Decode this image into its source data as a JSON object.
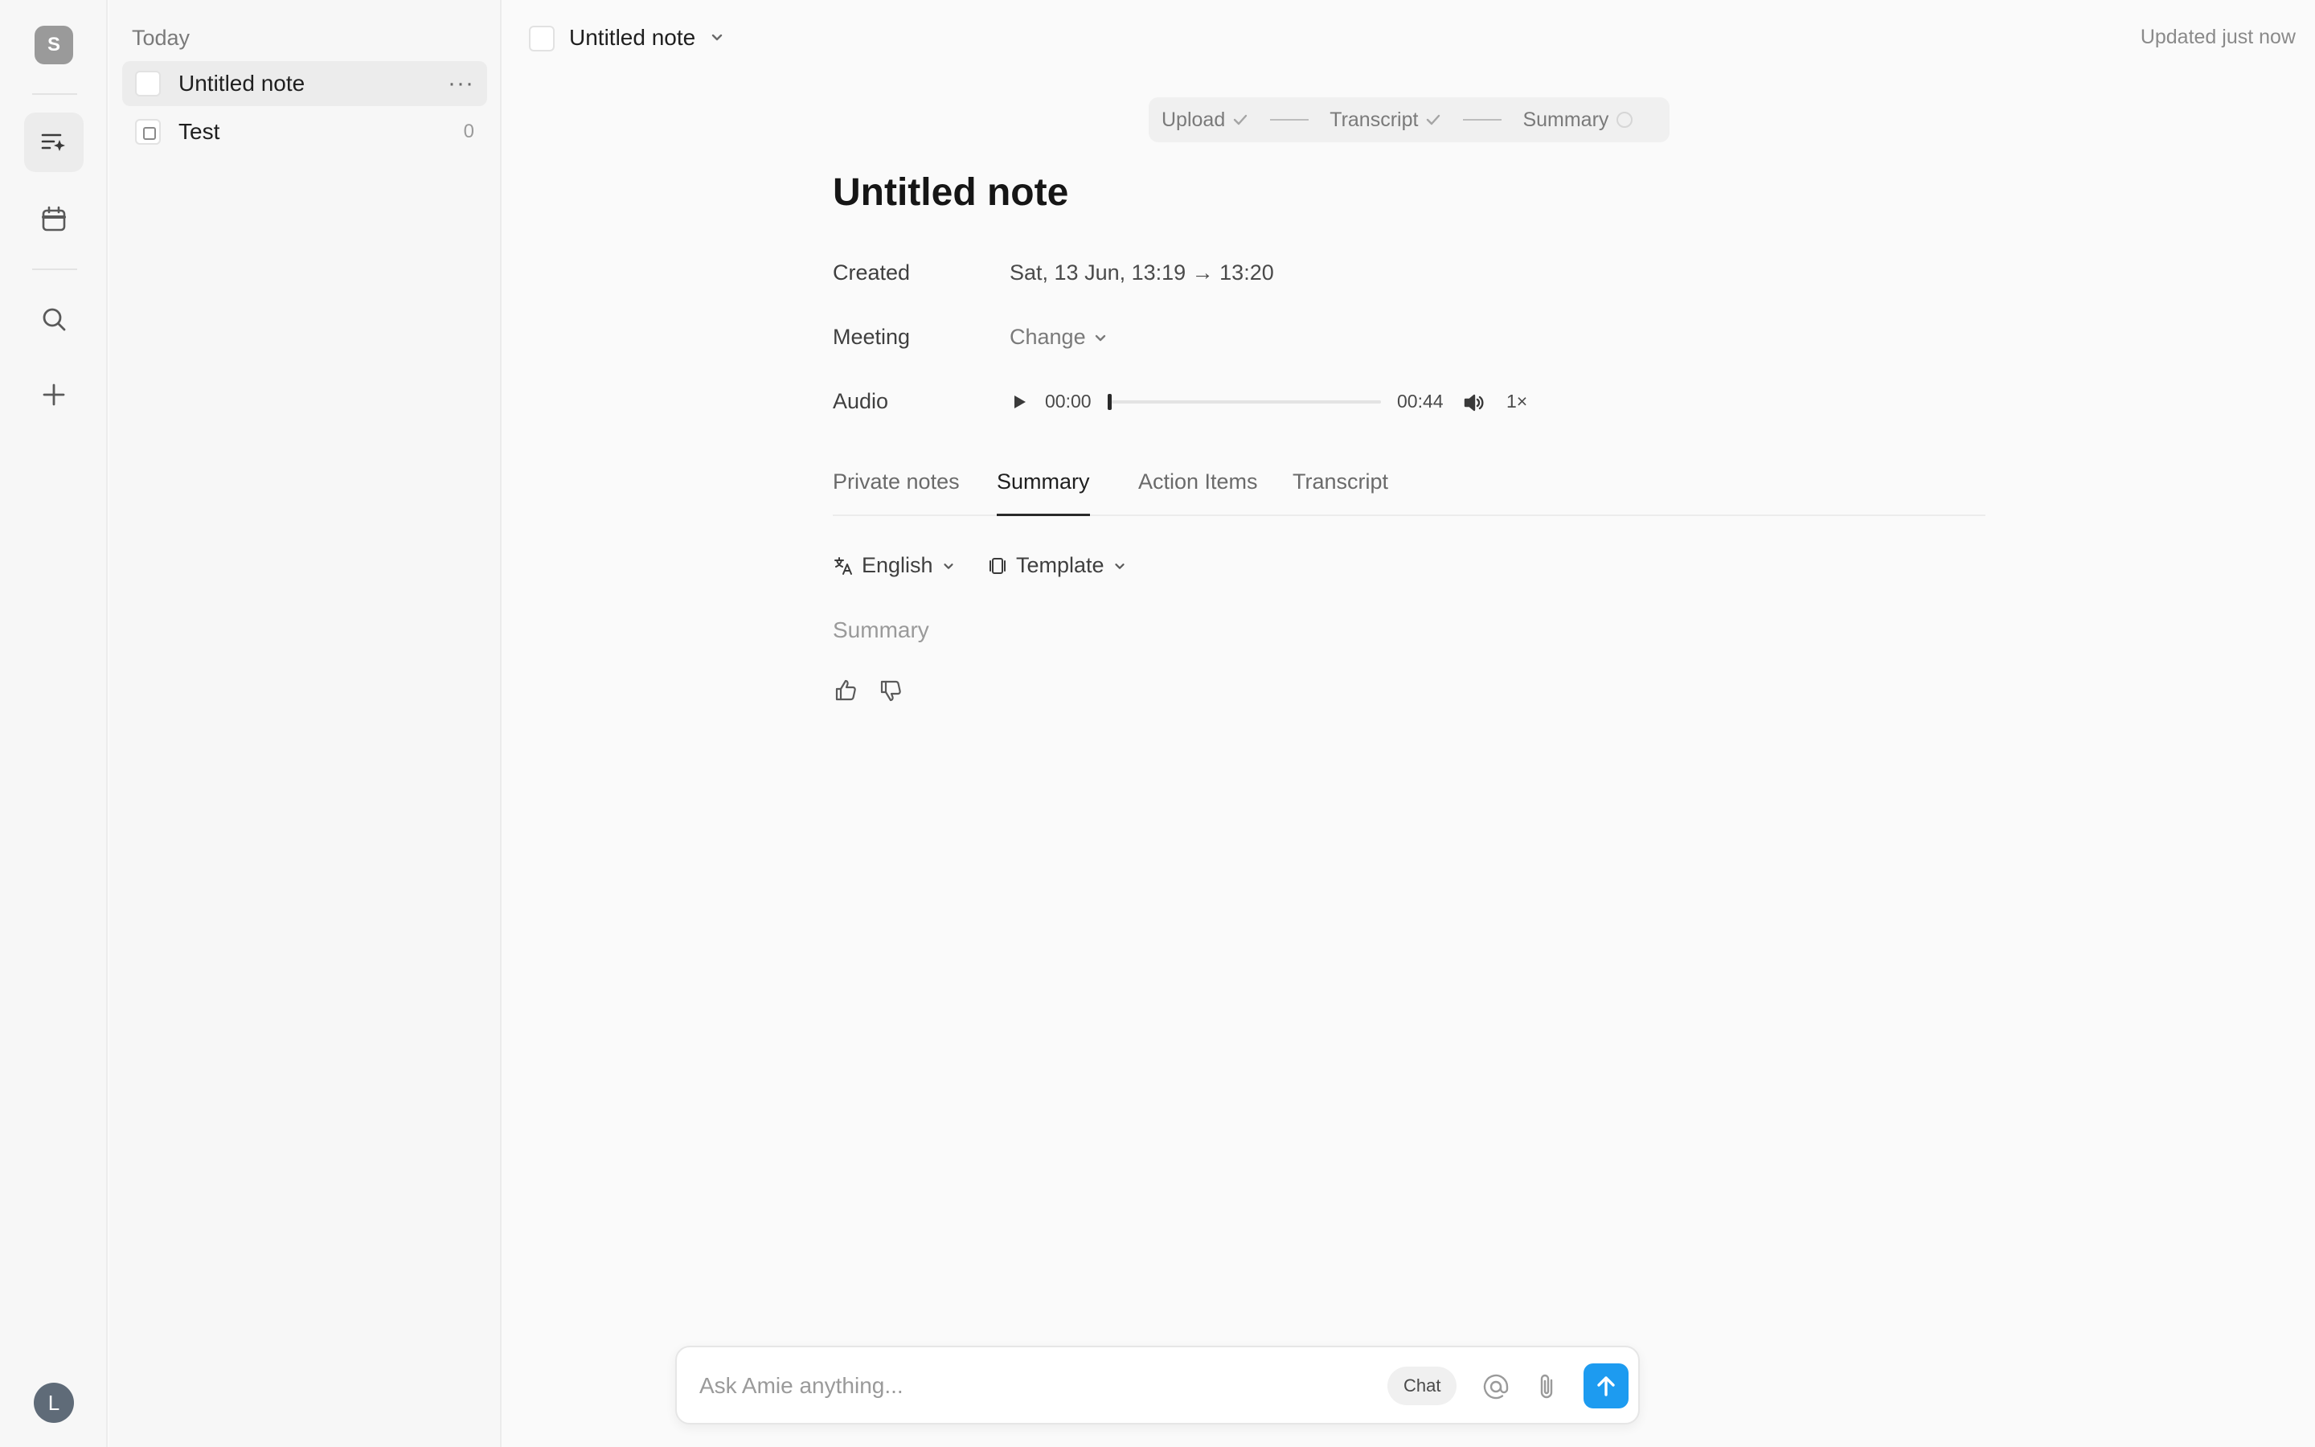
{
  "rail": {
    "workspace_initial": "S",
    "user_initial": "L",
    "icons": [
      "notes-sparkle-icon",
      "calendar-icon",
      "search-icon",
      "plus-icon"
    ]
  },
  "notes_list": {
    "group_label": "Today",
    "items": [
      {
        "title": "Untitled note",
        "selected": true,
        "more": "···"
      },
      {
        "title": "Test",
        "count": "0"
      }
    ]
  },
  "header": {
    "title": "Untitled note",
    "updated": "Updated just now"
  },
  "steps": {
    "upload": "Upload",
    "transcript": "Transcript",
    "summary": "Summary"
  },
  "note": {
    "title": "Untitled note",
    "created_label": "Created",
    "created_value": "Sat, 13 Jun, 13:19 → 13:20",
    "meeting_label": "Meeting",
    "meeting_value": "Change",
    "audio_label": "Audio",
    "audio": {
      "current": "00:00",
      "duration": "00:44",
      "speed": "1×",
      "progress": 0
    }
  },
  "tabs": [
    {
      "label": "Private notes"
    },
    {
      "label": "Summary",
      "active": true
    },
    {
      "label": "Action Items"
    },
    {
      "label": "Transcript"
    }
  ],
  "summary_toolbar": {
    "language": "English",
    "template": "Template"
  },
  "summary": {
    "placeholder": "Summary"
  },
  "chat": {
    "placeholder": "Ask Amie anything...",
    "mode": "Chat"
  },
  "colors": {
    "accent": "#1d9bf0",
    "background": "#fafafa"
  }
}
